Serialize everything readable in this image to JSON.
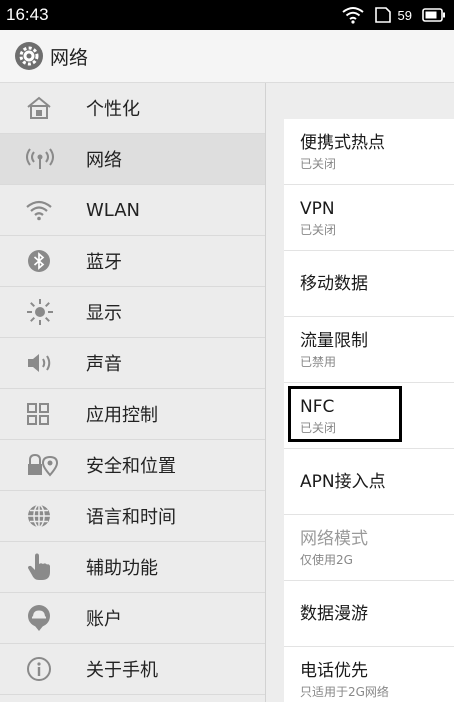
{
  "status_bar": {
    "time": "16:43",
    "battery_level": "59"
  },
  "header": {
    "title": "网络",
    "icon": "settings-gear-icon"
  },
  "menu": {
    "items": [
      {
        "label": "个性化",
        "icon": "home-icon",
        "active": false
      },
      {
        "label": "网络",
        "icon": "antenna-icon",
        "active": true
      },
      {
        "label": "WLAN",
        "icon": "wifi-icon",
        "active": false
      },
      {
        "label": "蓝牙",
        "icon": "bluetooth-icon",
        "active": false
      },
      {
        "label": "显示",
        "icon": "brightness-icon",
        "active": false
      },
      {
        "label": "声音",
        "icon": "speaker-icon",
        "active": false
      },
      {
        "label": "应用控制",
        "icon": "apps-grid-icon",
        "active": false
      },
      {
        "label": "安全和位置",
        "icon": "lock-location-icon",
        "active": false
      },
      {
        "label": "语言和时间",
        "icon": "globe-icon",
        "active": false
      },
      {
        "label": "辅助功能",
        "icon": "hand-pointer-icon",
        "active": false
      },
      {
        "label": "账户",
        "icon": "account-icon",
        "active": false
      },
      {
        "label": "关于手机",
        "icon": "info-icon",
        "active": false
      }
    ]
  },
  "detail": {
    "items": [
      {
        "title": "便携式热点",
        "subtitle": "已关闭"
      },
      {
        "title": "VPN",
        "subtitle": "已关闭"
      },
      {
        "title": "移动数据",
        "subtitle": ""
      },
      {
        "title": "流量限制",
        "subtitle": "已禁用"
      },
      {
        "title": "NFC",
        "subtitle": "已关闭",
        "highlighted": true
      },
      {
        "title": "APN接入点",
        "subtitle": ""
      },
      {
        "title": "网络模式",
        "subtitle": "仅使用2G",
        "disabled": true
      },
      {
        "title": "数据漫游",
        "subtitle": ""
      },
      {
        "title": "电话优先",
        "subtitle": "只适用于2G网络"
      }
    ]
  },
  "colors": {
    "status_bar": "#000000",
    "menu_bg": "#ececec",
    "menu_active": "#dedede",
    "highlight_border": "#000000"
  }
}
